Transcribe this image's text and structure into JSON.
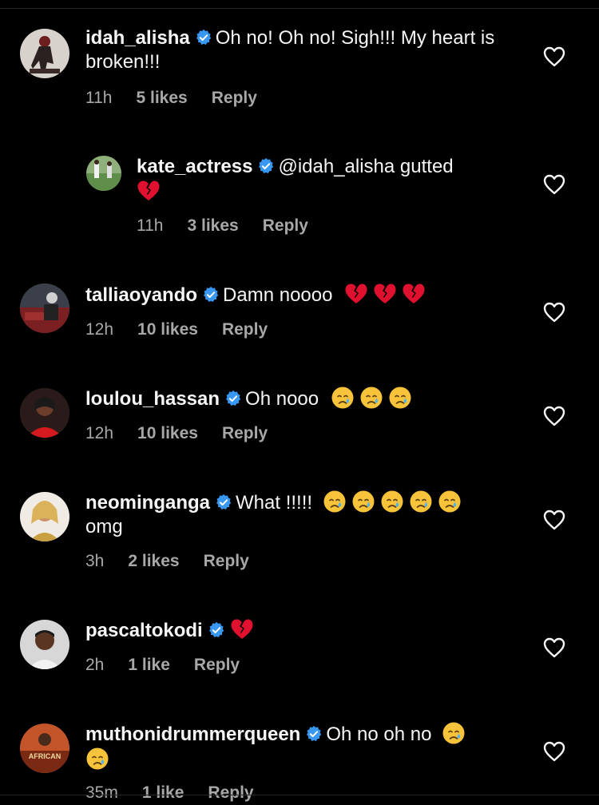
{
  "comments": [
    {
      "username": "idah_alisha",
      "text": "Oh no! Oh no! Sigh!!! My heart is broken!!!",
      "time": "11h",
      "likes": "5 likes",
      "reply": "Reply",
      "emojis": [],
      "avatar_icon": "avatar-photo"
    },
    {
      "username": "kate_actress",
      "text": "@idah_alisha gutted",
      "time": "11h",
      "likes": "3 likes",
      "reply": "Reply",
      "emojis": [
        "broken-heart"
      ],
      "avatar_icon": "avatar-photo"
    },
    {
      "username": "talliaoyando",
      "text": "Damn noooo",
      "time": "12h",
      "likes": "10 likes",
      "reply": "Reply",
      "emojis": [
        "broken-heart",
        "broken-heart",
        "broken-heart"
      ],
      "avatar_icon": "avatar-photo"
    },
    {
      "username": "loulou_hassan",
      "text": "Oh nooo",
      "time": "12h",
      "likes": "10 likes",
      "reply": "Reply",
      "emojis": [
        "crying-face",
        "crying-face",
        "crying-face"
      ],
      "avatar_icon": "avatar-photo"
    },
    {
      "username": "neominganga",
      "text": "What !!!!!",
      "text_after": "omg",
      "time": "3h",
      "likes": "2 likes",
      "reply": "Reply",
      "emojis": [
        "crying-face",
        "crying-face",
        "crying-face",
        "crying-face",
        "crying-face"
      ],
      "avatar_icon": "avatar-photo"
    },
    {
      "username": "pascaltokodi",
      "text": "",
      "time": "2h",
      "likes": "1 like",
      "reply": "Reply",
      "emojis": [
        "broken-heart"
      ],
      "avatar_icon": "avatar-photo"
    },
    {
      "username": "muthonidrummerqueen",
      "text": "Oh no oh no",
      "time": "35m",
      "likes": "1 like",
      "reply": "Reply",
      "emojis": [
        "crying-face",
        "crying-face"
      ],
      "avatar_icon": "avatar-photo"
    }
  ],
  "avatars": {
    "muthonidrummerqueen_text": "AFRICAN"
  },
  "colors": {
    "background": "#000000",
    "verified_blue": "#3897f0",
    "meta_gray": "#a8a8a8",
    "text": "#f5f5f5",
    "broken_heart_red": "#e0102f",
    "emoji_yellow": "#f7c33a",
    "tear_blue": "#4fb3f6"
  },
  "icons": {
    "like": "heart-outline-icon",
    "verified": "verified-badge-icon",
    "broken_heart": "broken-heart-emoji",
    "crying_face": "crying-face-emoji"
  }
}
